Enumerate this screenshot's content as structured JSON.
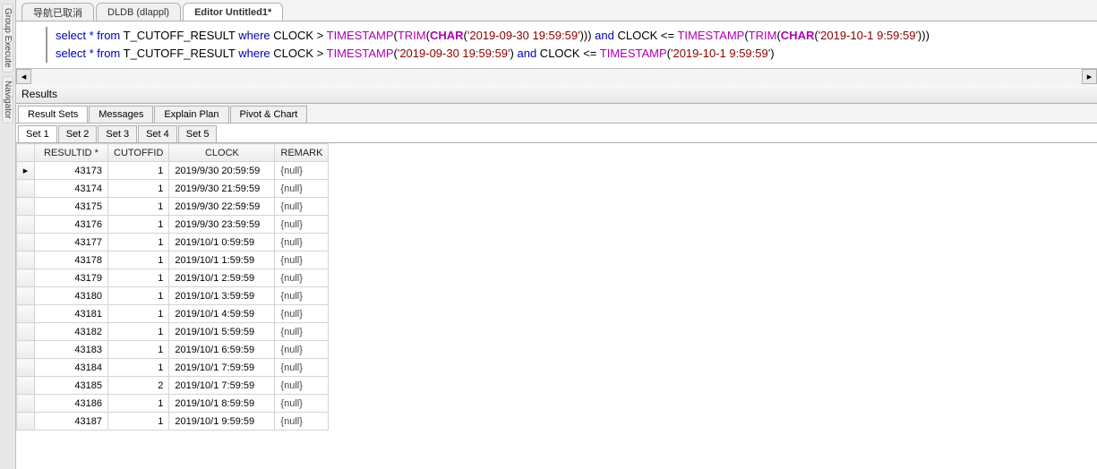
{
  "sidebar": {
    "items": [
      "Group Execute",
      "Navigator"
    ]
  },
  "topTabs": [
    {
      "label": "导航已取消",
      "active": false
    },
    {
      "label": "DLDB (dlappl)",
      "active": false
    },
    {
      "label": "Editor Untitled1*",
      "active": true
    }
  ],
  "sql": {
    "line1": {
      "p1": "select * ",
      "p2": "from",
      "p3": " T_CUTOFF_RESULT ",
      "p4": "where",
      "p5": " CLOCK > ",
      "p6": "TIMESTAMP",
      "p7": "(",
      "p8": "TRIM",
      "p9": "(",
      "p10": "CHAR",
      "p11": "(",
      "s1": "'2019-09-30 19:59:59'",
      "p12": ")))  ",
      "p13": "and",
      "p14": " CLOCK <= ",
      "p15": "TIMESTAMP",
      "p16": "(",
      "p17": "TRIM",
      "p18": "(",
      "p19": "CHAR",
      "p20": "(",
      "s2": "'2019-10-1 9:59:59'",
      "p21": ")))"
    },
    "line2": {
      "p1": "select * ",
      "p2": "from",
      "p3": " T_CUTOFF_RESULT ",
      "p4": "where",
      "p5": " CLOCK > ",
      "p6": "TIMESTAMP",
      "p7": "(",
      "s1": "'2019-09-30 19:59:59'",
      "p8": ")  ",
      "p9": "and",
      "p10": " CLOCK <= ",
      "p11": "TIMESTAMP",
      "p12": "(",
      "s2": "'2019-10-1 9:59:59'",
      "p13": ")"
    }
  },
  "resultsLabel": "Results",
  "resultTabs": [
    {
      "label": "Result Sets",
      "active": true
    },
    {
      "label": "Messages",
      "active": false
    },
    {
      "label": "Explain Plan",
      "active": false
    },
    {
      "label": "Pivot & Chart",
      "active": false
    }
  ],
  "setTabs": [
    {
      "label": "Set 1",
      "active": true
    },
    {
      "label": "Set 2",
      "active": false
    },
    {
      "label": "Set 3",
      "active": false
    },
    {
      "label": "Set 4",
      "active": false
    },
    {
      "label": "Set 5",
      "active": false
    }
  ],
  "columns": [
    "RESULTID *",
    "CUTOFFID",
    "CLOCK",
    "REMARK"
  ],
  "rows": [
    {
      "resultid": "43173",
      "cutoffid": "1",
      "clock": "2019/9/30 20:59:59",
      "remark": "{null}",
      "sel": "▸"
    },
    {
      "resultid": "43174",
      "cutoffid": "1",
      "clock": "2019/9/30 21:59:59",
      "remark": "{null}",
      "sel": ""
    },
    {
      "resultid": "43175",
      "cutoffid": "1",
      "clock": "2019/9/30 22:59:59",
      "remark": "{null}",
      "sel": ""
    },
    {
      "resultid": "43176",
      "cutoffid": "1",
      "clock": "2019/9/30 23:59:59",
      "remark": "{null}",
      "sel": ""
    },
    {
      "resultid": "43177",
      "cutoffid": "1",
      "clock": "2019/10/1 0:59:59",
      "remark": "{null}",
      "sel": ""
    },
    {
      "resultid": "43178",
      "cutoffid": "1",
      "clock": "2019/10/1 1:59:59",
      "remark": "{null}",
      "sel": ""
    },
    {
      "resultid": "43179",
      "cutoffid": "1",
      "clock": "2019/10/1 2:59:59",
      "remark": "{null}",
      "sel": ""
    },
    {
      "resultid": "43180",
      "cutoffid": "1",
      "clock": "2019/10/1 3:59:59",
      "remark": "{null}",
      "sel": ""
    },
    {
      "resultid": "43181",
      "cutoffid": "1",
      "clock": "2019/10/1 4:59:59",
      "remark": "{null}",
      "sel": ""
    },
    {
      "resultid": "43182",
      "cutoffid": "1",
      "clock": "2019/10/1 5:59:59",
      "remark": "{null}",
      "sel": ""
    },
    {
      "resultid": "43183",
      "cutoffid": "1",
      "clock": "2019/10/1 6:59:59",
      "remark": "{null}",
      "sel": ""
    },
    {
      "resultid": "43184",
      "cutoffid": "1",
      "clock": "2019/10/1 7:59:59",
      "remark": "{null}",
      "sel": ""
    },
    {
      "resultid": "43185",
      "cutoffid": "2",
      "clock": "2019/10/1 7:59:59",
      "remark": "{null}",
      "sel": ""
    },
    {
      "resultid": "43186",
      "cutoffid": "1",
      "clock": "2019/10/1 8:59:59",
      "remark": "{null}",
      "sel": ""
    },
    {
      "resultid": "43187",
      "cutoffid": "1",
      "clock": "2019/10/1 9:59:59",
      "remark": "{null}",
      "sel": ""
    }
  ],
  "glyphs": {
    "left": "◂",
    "right": "▸"
  }
}
